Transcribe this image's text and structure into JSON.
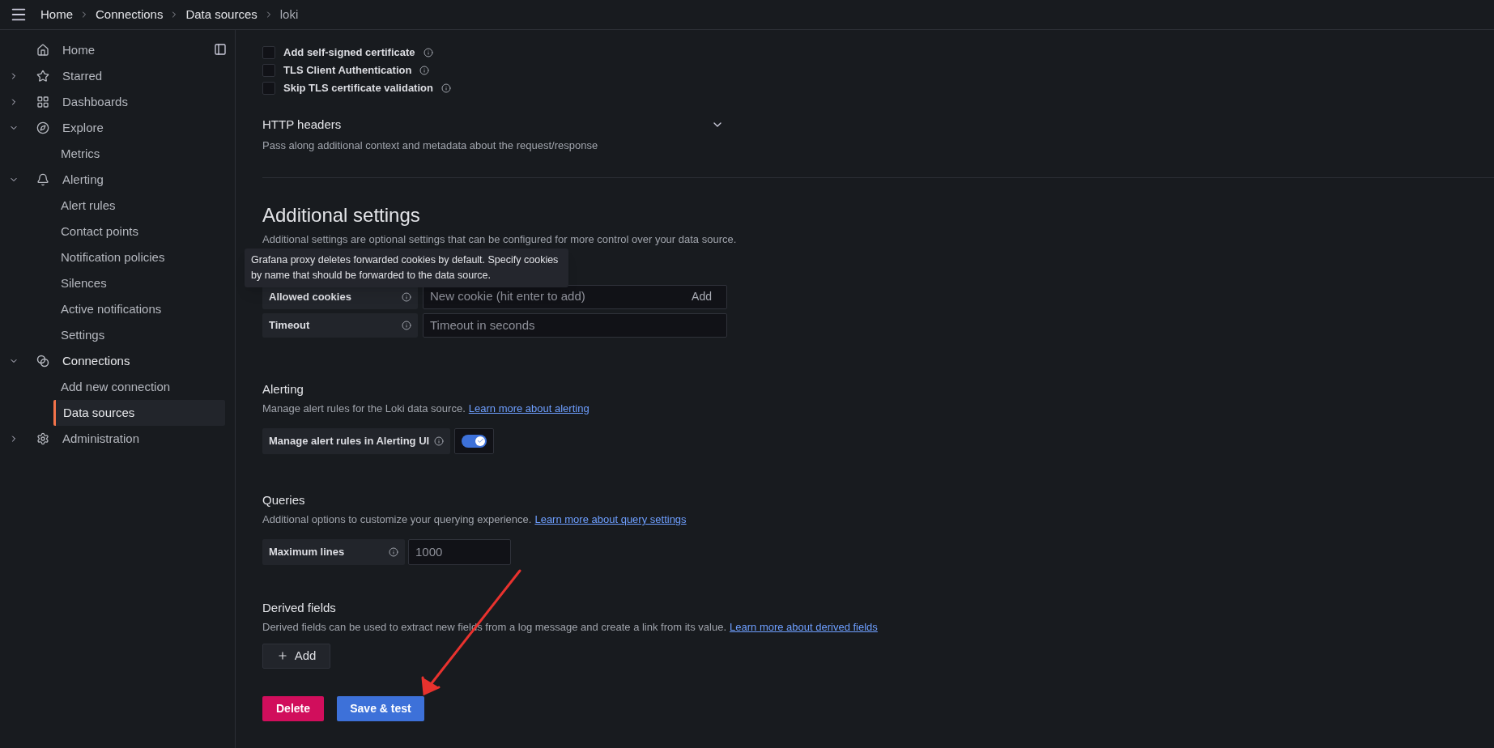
{
  "breadcrumbs": [
    "Home",
    "Connections",
    "Data sources",
    "loki"
  ],
  "sidebar": {
    "items": [
      {
        "label": "Home",
        "selected": false
      },
      {
        "label": "Starred",
        "selected": false,
        "expanded": false
      },
      {
        "label": "Dashboards",
        "selected": false,
        "expanded": false
      },
      {
        "label": "Explore",
        "selected": false,
        "expanded": true,
        "children": [
          {
            "label": "Metrics",
            "selected": false
          }
        ]
      },
      {
        "label": "Alerting",
        "selected": false,
        "expanded": true,
        "children": [
          {
            "label": "Alert rules",
            "selected": false
          },
          {
            "label": "Contact points",
            "selected": false
          },
          {
            "label": "Notification policies",
            "selected": false
          },
          {
            "label": "Silences",
            "selected": false
          },
          {
            "label": "Active notifications",
            "selected": false
          },
          {
            "label": "Settings",
            "selected": false
          }
        ]
      },
      {
        "label": "Connections",
        "selected": false,
        "expanded": true,
        "children": [
          {
            "label": "Add new connection",
            "selected": false
          },
          {
            "label": "Data sources",
            "selected": true
          }
        ]
      },
      {
        "label": "Administration",
        "selected": false,
        "expanded": false
      }
    ]
  },
  "tls_options": [
    {
      "label": "Add self-signed certificate",
      "checked": false
    },
    {
      "label": "TLS Client Authentication",
      "checked": false
    },
    {
      "label": "Skip TLS certificate validation",
      "checked": false
    }
  ],
  "http_headers": {
    "title": "HTTP headers",
    "description": "Pass along additional context and metadata about the request/response",
    "expanded": false
  },
  "additional_settings": {
    "title": "Additional settings",
    "description": "Additional settings are optional settings that can be configured for more control over your data source.",
    "tooltip": "Grafana proxy deletes forwarded cookies by default. Specify cookies by name that should be forwarded to the data source.",
    "fields": [
      {
        "label": "Allowed cookies",
        "placeholder": "New cookie (hit enter to add)",
        "action": "Add"
      },
      {
        "label": "Timeout",
        "placeholder": "Timeout in seconds"
      }
    ]
  },
  "alerting": {
    "title": "Alerting",
    "description": "Manage alert rules for the Loki data source.",
    "link": "Learn more about alerting",
    "toggle_label": "Manage alert rules in Alerting UI",
    "on": true
  },
  "queries": {
    "title": "Queries",
    "description": "Additional options to customize your querying experience.",
    "link": "Learn more about query settings",
    "field_label": "Maximum lines",
    "placeholder": "1000"
  },
  "derived_fields": {
    "title": "Derived fields",
    "description": "Derived fields can be used to extract new fields from a log message and create a link from its value.",
    "link": "Learn more about derived fields",
    "add_button": "Add"
  },
  "buttons": {
    "delete": "Delete",
    "save": "Save & test"
  }
}
